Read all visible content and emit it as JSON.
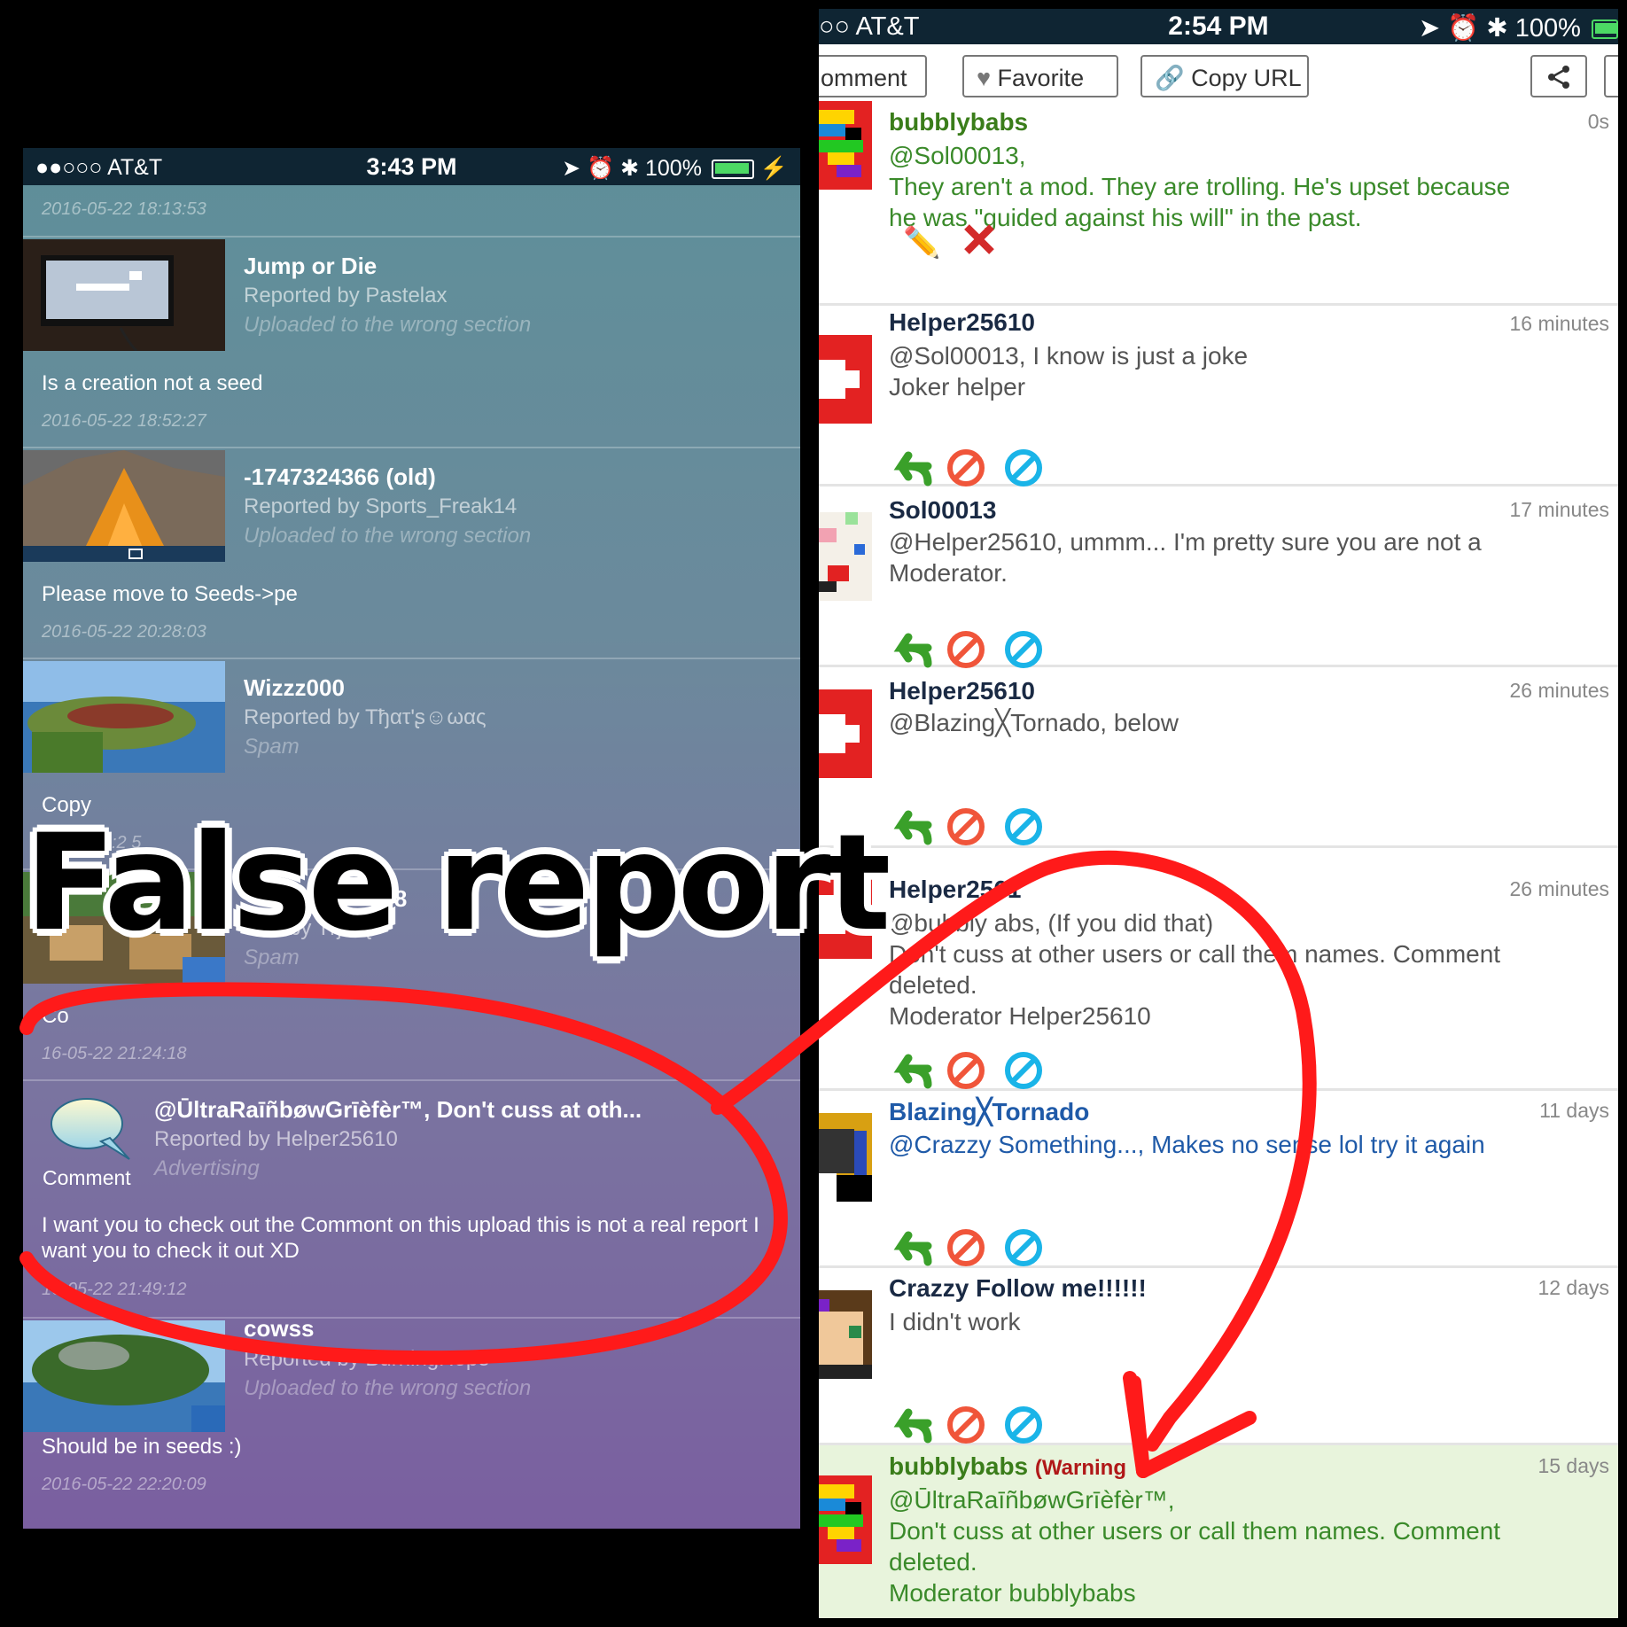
{
  "left": {
    "status_bar": {
      "signal": "●●○○○ AT&T",
      "time": "3:43 PM",
      "battery": "100%"
    },
    "reports": [
      {
        "timestamp_before": "2016-05-22 18:13:53",
        "title": "Jump or Die",
        "reported_by": "Reported by Pastelax",
        "reason": "Uploaded to the wrong section",
        "description": "Is a creation not a seed",
        "timestamp": "2016-05-22 18:52:27"
      },
      {
        "title": "-1747324366 (old)",
        "reported_by": "Reported by Sports_Freak14",
        "reason": "Uploaded to the wrong section",
        "description": "Please move to Seeds->pe",
        "timestamp": "2016-05-22 20:28:03"
      },
      {
        "title": "Wizzz000",
        "reported_by": "Reported by Tђατ'ʂ☺ωας",
        "reason": "Spam",
        "description": "Copy",
        "timestamp": "05-22 21:2  5"
      },
      {
        "title": "368",
        "reported_by": "by Tђατ'ʂ",
        "reason": "Spam",
        "description": "Co",
        "timestamp": "16-05-22 21:24:18"
      },
      {
        "thumb_label": "Comment",
        "title": "@ŪltraRaīñbøwGrīèfèr™, Don't cuss at oth...",
        "reported_by": "Reported by Helper25610",
        "reason": "Advertising",
        "description": "I want you to check out the Commont on this upload this is not a real report I want you to check it out XD",
        "timestamp": "16-05-22 21:49:12"
      },
      {
        "title": "cowss",
        "reported_by": "Reported by BurningHope",
        "reason": "Uploaded to the wrong section",
        "description": "Should be in seeds :)",
        "timestamp": "2016-05-22 22:20:09"
      }
    ]
  },
  "right": {
    "status_bar": {
      "signal": "○○ AT&T",
      "time": "2:54 PM",
      "battery": "100%"
    },
    "toolbar": {
      "comment": "omment",
      "favorite": "Favorite",
      "copy_url": "Copy URL"
    },
    "comments": [
      {
        "name": "bubblybabs",
        "time": "0s",
        "body": "@Sol00013,\nThey aren't a mod. They are trolling. He's upset because he was \"guided against his will\" in the past."
      },
      {
        "name": "Helper25610",
        "time": "16 minutes",
        "body": "@Sol00013, I know is just a joke\nJoker helper"
      },
      {
        "name": "Sol00013",
        "time": "17 minutes",
        "body": "@Helper25610, ummm... I'm pretty sure you are not a Moderator."
      },
      {
        "name": "Helper25610",
        "time": "26 minutes",
        "body": "@Blazing╳Tornado, below"
      },
      {
        "name": "Helper2561",
        "time": "26 minutes",
        "body": "@bubbly abs, (If you did that)\nDon't cuss at other users or call them names. Comment deleted.\nModerator Helper25610"
      },
      {
        "name": "Blazing╳Tornado",
        "time": "11 days",
        "body": "@Crazzy Something..., Makes no sense lol try it again"
      },
      {
        "name": "Crazzy Follow me!!!!!!",
        "time": "12 days",
        "body": "I didn't work"
      },
      {
        "name": "bubblybabs",
        "warning": "(Warning",
        "time": "15 days",
        "body": "@ŪltraRaīñbøwGrīèfèr™,\nDon't cuss at other users or call them names. Comment deleted.\nModerator bubblybabs"
      }
    ]
  },
  "overlay": {
    "caption": "False report"
  },
  "colors": {
    "annotation_red": "#ff1a1a",
    "reply_green": "#3aa02a",
    "block_red": "#f0553a",
    "block_cyan": "#1ab4e8"
  }
}
